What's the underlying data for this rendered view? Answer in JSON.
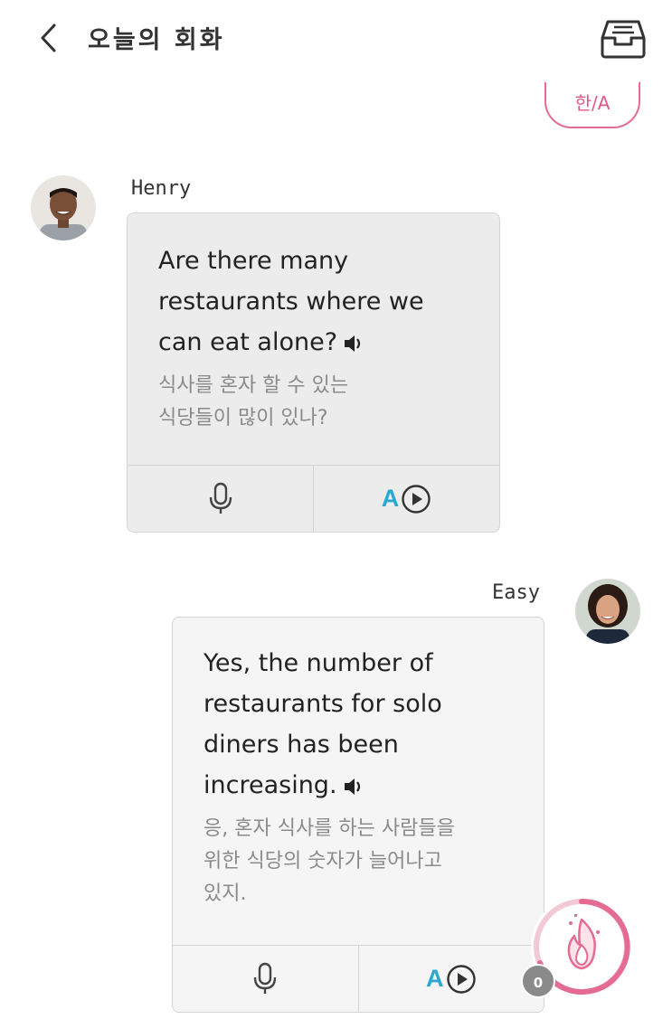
{
  "header": {
    "title": "오늘의 회화",
    "back_icon": "chevron-left-icon",
    "inbox_icon": "inbox-tray-icon"
  },
  "language_toggle": {
    "label": "한/A"
  },
  "messages": [
    {
      "speaker": "Henry",
      "english": [
        "Are there many",
        "restaurants where we",
        "can eat alone?"
      ],
      "korean": [
        "식사를 혼자 할 수 있는",
        "식당들이 많이 있나?"
      ],
      "actions": {
        "record_icon": "microphone-icon",
        "play_label": "A",
        "play_icon": "play-circle-icon"
      }
    },
    {
      "speaker": "Easy",
      "english": [
        "Yes, the number of",
        "restaurants for solo",
        "diners has been",
        "increasing."
      ],
      "korean": [
        "응, 혼자 식사를 하는 사람들을",
        "위한 식당의 숫자가 늘어나고",
        "있지."
      ],
      "actions": {
        "record_icon": "microphone-icon",
        "play_label": "A",
        "play_icon": "play-circle-icon"
      }
    }
  ],
  "fab": {
    "icon": "flame-icon",
    "count": "0"
  },
  "colors": {
    "accent_pink": "#e46c92",
    "accent_blue": "#29a9d1",
    "bubble_gray": "#ececec"
  }
}
